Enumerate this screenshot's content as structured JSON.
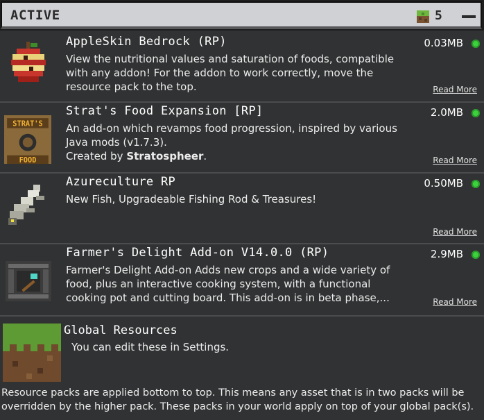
{
  "header": {
    "title": "ACTIVE",
    "count": "5",
    "count_icon": "grass-block-icon"
  },
  "packs": [
    {
      "name": "AppleSkin Bedrock (RP)",
      "desc_pre": "View the nutritional values and saturation of foods, compatible with any addon! For the addon to work correctly, move the resource pack to the top.",
      "desc_bold": "",
      "desc_post": "",
      "size": "0.03MB",
      "read_more": "Read More",
      "icon": "apple-icon"
    },
    {
      "name": "Strat's Food Expansion [RP]",
      "desc_pre": "An add-on which revamps food progression, inspired by various Java mods (v1.7.3).\nCreated by ",
      "desc_bold": "Stratospheer",
      "desc_post": ".",
      "size": "2.0MB",
      "read_more": "Read More",
      "icon": "strats-food-logo-icon",
      "icon_text_top": "STRAT'S",
      "icon_text_bottom": "FOOD"
    },
    {
      "name": "Azureculture RP",
      "desc_pre": "New Fish, Upgradeable Fishing Rod & Treasures!",
      "desc_bold": "",
      "desc_post": "",
      "size": "0.50MB",
      "read_more": "Read More",
      "icon": "fish-icon"
    },
    {
      "name": "Farmer's Delight Add-on V14.0.0 (RP)",
      "desc_pre": "Farmer's Delight Add-on Adds new crops and a wide variety of food, plus an interactive cooking system, with a functional cooking pot and cutting board. This add-on is in beta phase,...",
      "desc_bold": "",
      "desc_post": "",
      "size": "2.9MB",
      "read_more": "Read More",
      "icon": "cooking-table-icon"
    }
  ],
  "global": {
    "title": "Global Resources",
    "subtitle": "You can edit these in Settings.",
    "icon": "grass-block-icon"
  },
  "footer": {
    "note": "Resource packs are applied bottom to top. This means any asset that is in two packs will be overridden by the higher pack. These packs in your world apply on top of your global pack(s)."
  },
  "colors": {
    "status_active": "#3dd13d",
    "background": "#313233",
    "header": "#d0d1d4"
  }
}
